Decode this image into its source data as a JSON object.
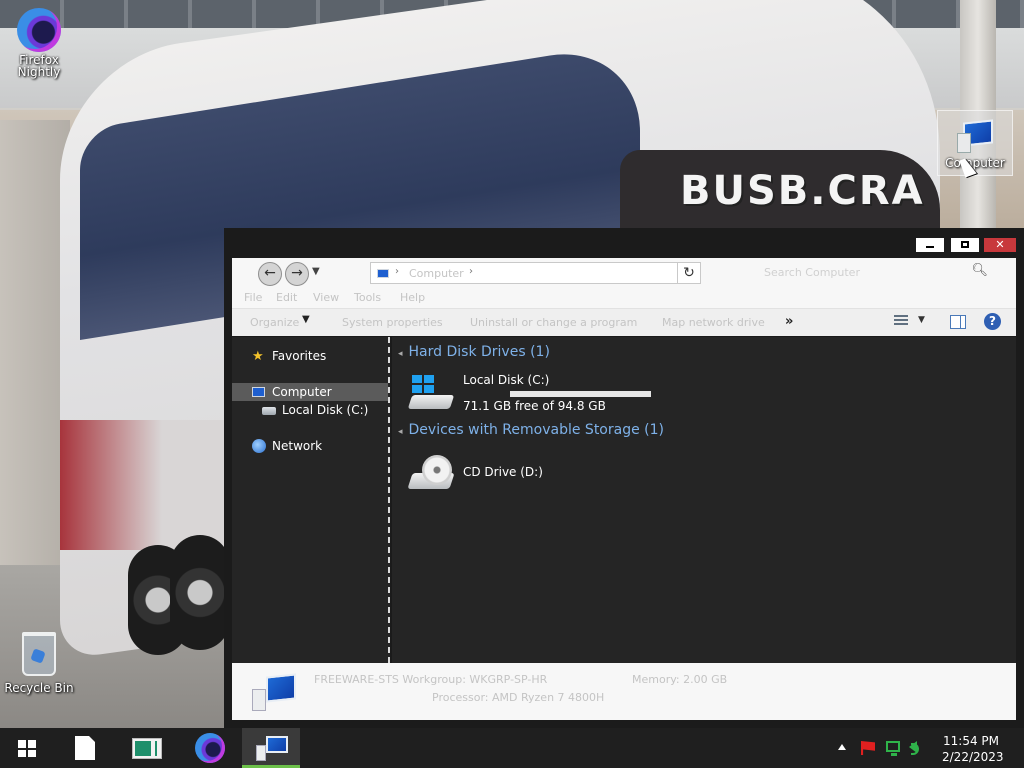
{
  "desktop": {
    "icons": [
      {
        "label_line1": "Firefox",
        "label_line2": "Nightly"
      },
      {
        "label": "Computer"
      },
      {
        "label": "Recycle Bin"
      }
    ],
    "wallpaper_text": "BUSB.CRA"
  },
  "window": {
    "address": {
      "path": "Computer",
      "placeholder": "Search Computer"
    },
    "menu": [
      "File",
      "Edit",
      "View",
      "Tools",
      "Help"
    ],
    "toolbar": {
      "organize": "Organize",
      "system_properties": "System properties",
      "uninstall": "Uninstall or change a program",
      "map_drive": "Map network drive",
      "more": "»"
    },
    "nav": {
      "favorites": "Favorites",
      "computer": "Computer",
      "local_disk": "Local Disk (C:)",
      "network": "Network"
    },
    "groups": {
      "hdd": "Hard Disk Drives (1)",
      "removable": "Devices with Removable Storage (1)"
    },
    "drives": {
      "c": {
        "name": "Local Disk (C:)",
        "free_text": "71.1 GB free of 94.8 GB",
        "used_fraction": 0.25
      },
      "d": {
        "name": "CD Drive (D:)"
      }
    },
    "details": {
      "workgroup": "FREEWARE-STS  Workgroup: WKGRP-SP-HR",
      "memory": "Memory: 2.00 GB",
      "processor": "Processor: AMD Ryzen 7 4800H"
    }
  },
  "taskbar": {
    "time": "11:54 PM",
    "date": "2/22/2023"
  },
  "colors": {
    "accent_blue": "#7eb1e8",
    "close_red": "#c8383c",
    "active_task_underline": "#6cc04a"
  }
}
